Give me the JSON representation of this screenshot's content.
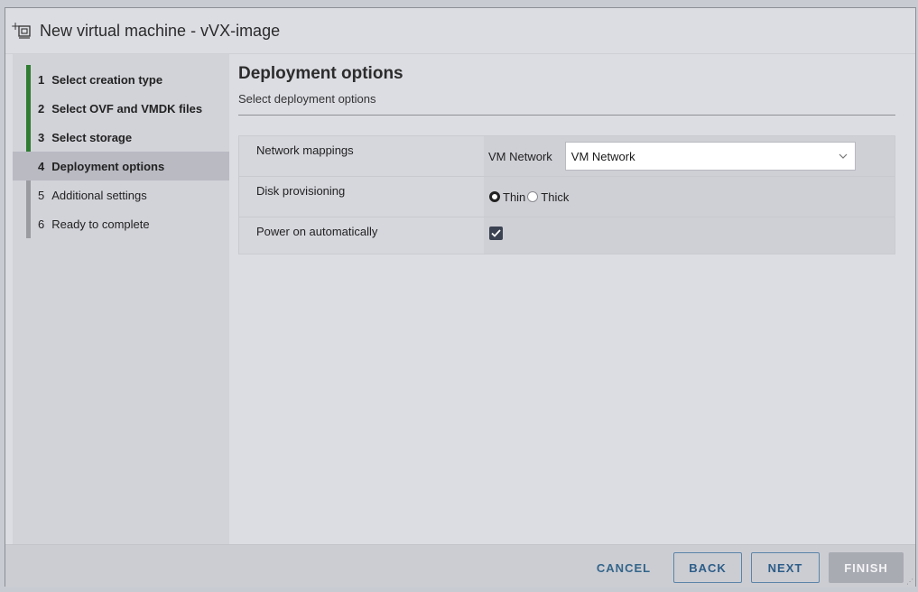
{
  "window": {
    "title": "New virtual machine - vVX-image"
  },
  "sidebar": {
    "steps": [
      {
        "num": "1",
        "label": "Select creation type",
        "state": "done"
      },
      {
        "num": "2",
        "label": "Select OVF and VMDK files",
        "state": "done"
      },
      {
        "num": "3",
        "label": "Select storage",
        "state": "done"
      },
      {
        "num": "4",
        "label": "Deployment options",
        "state": "active"
      },
      {
        "num": "5",
        "label": "Additional settings",
        "state": "pending"
      },
      {
        "num": "6",
        "label": "Ready to complete",
        "state": "pending"
      }
    ]
  },
  "main": {
    "title": "Deployment options",
    "subtitle": "Select deployment options",
    "rows": {
      "network": {
        "label": "Network mappings",
        "source": "VM Network",
        "selected": "VM Network"
      },
      "disk": {
        "label": "Disk provisioning",
        "options": [
          "Thin",
          "Thick"
        ],
        "selected": "Thin"
      },
      "power": {
        "label": "Power on automatically",
        "checked": true
      }
    }
  },
  "footer": {
    "cancel": "CANCEL",
    "back": "BACK",
    "next": "NEXT",
    "finish": "FINISH"
  },
  "colors": {
    "progress_done": "#2f7d32",
    "progress_pending": "#9a9ba1",
    "primary_text": "#2c5d88",
    "disabled_button": "#a9abb3"
  }
}
